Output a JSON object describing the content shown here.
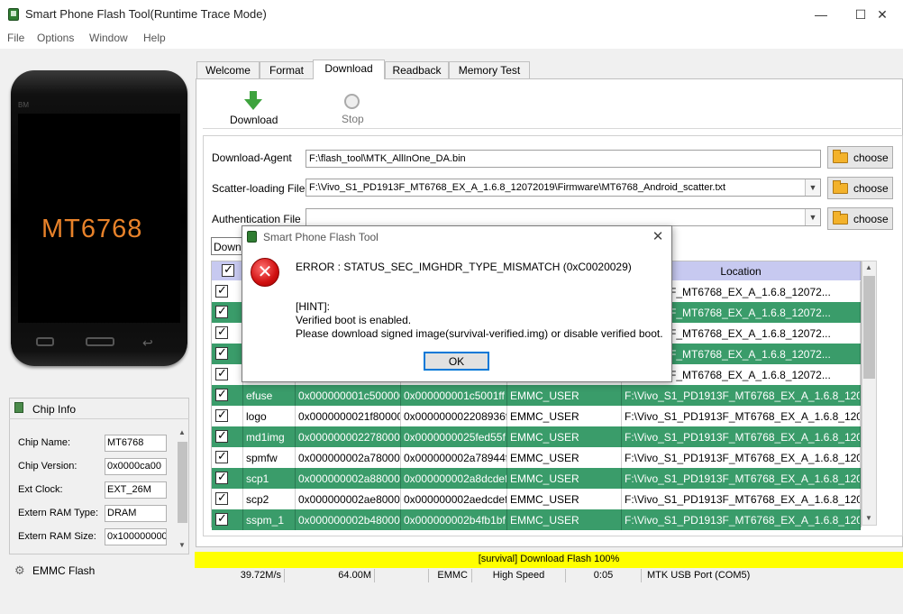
{
  "window": {
    "title": "Smart Phone Flash Tool(Runtime Trace Mode)",
    "minimize": "—",
    "maximize": "☐",
    "close": "✕"
  },
  "menu": [
    "File",
    "Options",
    "Window",
    "Help"
  ],
  "phone": {
    "brand": "BM",
    "chip": "MT6768"
  },
  "chip_info": {
    "header": "Chip Info",
    "fields": [
      {
        "label": "Chip Name:",
        "value": "MT6768"
      },
      {
        "label": "Chip Version:",
        "value": "0x0000ca00"
      },
      {
        "label": "Ext Clock:",
        "value": "EXT_26M"
      },
      {
        "label": "Extern RAM Type:",
        "value": "DRAM"
      },
      {
        "label": "Extern RAM Size:",
        "value": "0x100000000"
      }
    ],
    "emmc_flash": "EMMC Flash"
  },
  "tabs": [
    "Welcome",
    "Format",
    "Download",
    "Readback",
    "Memory Test"
  ],
  "toolbar": {
    "download": "Download",
    "stop": "Stop"
  },
  "form": {
    "download_agent_label": "Download-Agent",
    "download_agent_value": "F:\\flash_tool\\MTK_AllInOne_DA.bin",
    "scatter_label": "Scatter-loading File",
    "scatter_value": "F:\\Vivo_S1_PD1913F_MT6768_EX_A_1.6.8_12072019\\Firmware\\MT6768_Android_scatter.txt",
    "auth_label": "Authentication File",
    "auth_value": "",
    "choose": "choose",
    "mode_partial": "Downl"
  },
  "table": {
    "location_header": "Location",
    "rows": [
      {
        "name": "",
        "begin": "",
        "end": "",
        "region": "",
        "location": "_PD1913F_MT6768_EX_A_1.6.8_12072...",
        "color": "white"
      },
      {
        "name": "",
        "begin": "",
        "end": "",
        "region": "",
        "location": "_PD1913F_MT6768_EX_A_1.6.8_12072...",
        "color": "green"
      },
      {
        "name": "",
        "begin": "",
        "end": "",
        "region": "",
        "location": "_PD1913F_MT6768_EX_A_1.6.8_12072...",
        "color": "white"
      },
      {
        "name": "",
        "begin": "",
        "end": "",
        "region": "",
        "location": "_PD1913F_MT6768_EX_A_1.6.8_12072...",
        "color": "green"
      },
      {
        "name": "",
        "begin": "",
        "end": "",
        "region": "",
        "location": "_PD1913F_MT6768_EX_A_1.6.8_12072...",
        "color": "white"
      },
      {
        "name": "efuse",
        "begin": "0x000000001c500000",
        "end": "0x000000001c5001ff",
        "region": "EMMC_USER",
        "location": "F:\\Vivo_S1_PD1913F_MT6768_EX_A_1.6.8_12072...",
        "color": "green"
      },
      {
        "name": "logo",
        "begin": "0x0000000021f80000",
        "end": "0x000000002208936f",
        "region": "EMMC_USER",
        "location": "F:\\Vivo_S1_PD1913F_MT6768_EX_A_1.6.8_12072...",
        "color": "white"
      },
      {
        "name": "md1img",
        "begin": "0x0000000022780000",
        "end": "0x0000000025fed55f",
        "region": "EMMC_USER",
        "location": "F:\\Vivo_S1_PD1913F_MT6768_EX_A_1.6.8_12072...",
        "color": "green"
      },
      {
        "name": "spmfw",
        "begin": "0x000000002a780000",
        "end": "0x000000002a78944f",
        "region": "EMMC_USER",
        "location": "F:\\Vivo_S1_PD1913F_MT6768_EX_A_1.6.8_12072...",
        "color": "white"
      },
      {
        "name": "scp1",
        "begin": "0x000000002a880000",
        "end": "0x000000002a8dcdef",
        "region": "EMMC_USER",
        "location": "F:\\Vivo_S1_PD1913F_MT6768_EX_A_1.6.8_12072...",
        "color": "green"
      },
      {
        "name": "scp2",
        "begin": "0x000000002ae80000",
        "end": "0x000000002aedcdef",
        "region": "EMMC_USER",
        "location": "F:\\Vivo_S1_PD1913F_MT6768_EX_A_1.6.8_12072...",
        "color": "white"
      },
      {
        "name": "sspm_1",
        "begin": "0x000000002b480000",
        "end": "0x000000002b4fb1bf",
        "region": "EMMC_USER",
        "location": "F:\\Vivo_S1_PD1913F_MT6768_EX_A_1.6.8_12072...",
        "color": "green"
      }
    ]
  },
  "status": {
    "banner": "[survival] Download Flash 100%",
    "speed": "39.72M/s",
    "size": "64.00M",
    "storage": "EMMC",
    "usb_speed": "High Speed",
    "time": "0:05",
    "port": "MTK USB Port (COM5)"
  },
  "dialog": {
    "title": "Smart Phone Flash Tool",
    "error": "ERROR : STATUS_SEC_IMGHDR_TYPE_MISMATCH (0xC0020029)",
    "hint": "[HINT]:",
    "line1": "Verified boot is enabled.",
    "line2": "Please download signed image(survival-verified.img) or disable verified boot.",
    "ok": "OK"
  },
  "colors": {
    "row_green": "#3a9c6a",
    "header_purple": "#c7c9f0",
    "status_yellow": "#ffff00"
  }
}
